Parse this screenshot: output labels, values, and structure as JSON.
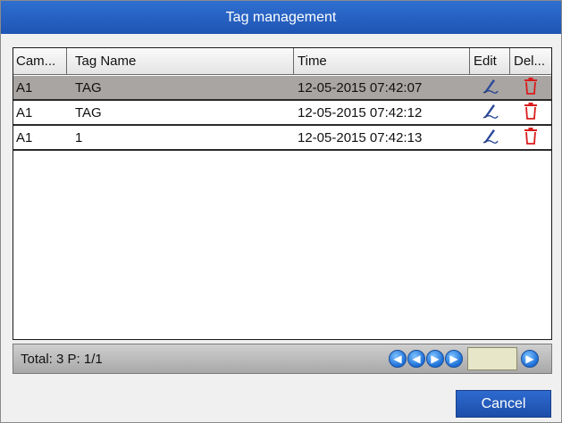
{
  "window": {
    "title": "Tag management"
  },
  "table": {
    "columns": [
      "Cam...",
      "Tag Name",
      "Time",
      "Edit",
      "Del..."
    ],
    "rows": [
      {
        "camera": "A1",
        "tag_name": "TAG",
        "time": "12-05-2015 07:42:07",
        "selected": true
      },
      {
        "camera": "A1",
        "tag_name": "TAG",
        "time": "12-05-2015 07:42:12",
        "selected": false
      },
      {
        "camera": "A1",
        "tag_name": "1",
        "time": "12-05-2015 07:42:13",
        "selected": false
      }
    ]
  },
  "footer": {
    "total_text": "Total: 3 P: 1/1",
    "page_input_value": "",
    "nav_icons": [
      "first-page-icon",
      "prev-page-icon",
      "next-page-icon",
      "last-page-icon",
      "go-page-icon"
    ]
  },
  "buttons": {
    "cancel_label": "Cancel"
  },
  "colors": {
    "title_bar": "#1f55b4",
    "selected_row": "#a9a5a2",
    "delete_icon": "#d91c1c",
    "edit_icon": "#1f3f8f"
  }
}
